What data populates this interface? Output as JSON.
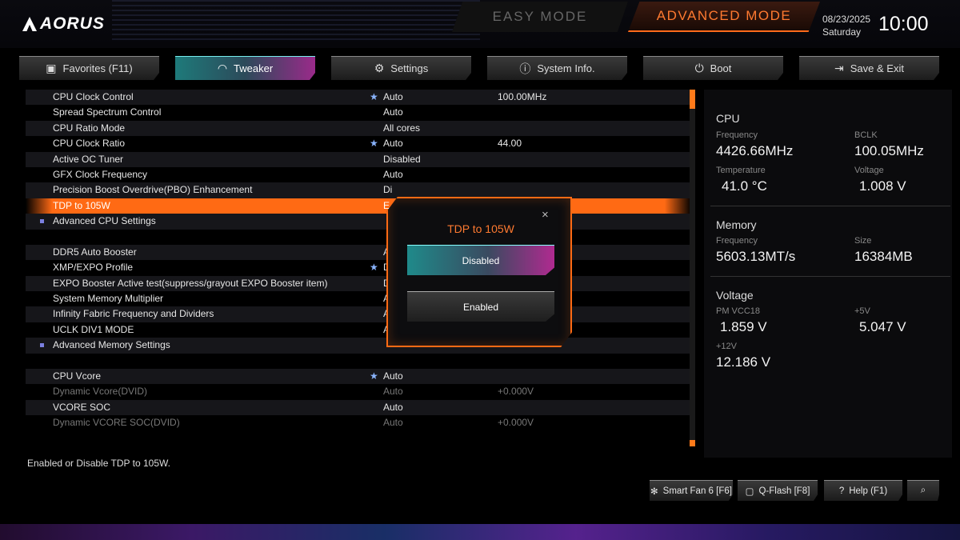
{
  "header": {
    "logo": "AORUS",
    "easy_mode": "EASY MODE",
    "advanced_mode": "ADVANCED MODE",
    "date": "08/23/2025",
    "weekday": "Saturday",
    "time": "10:00"
  },
  "tabs": [
    {
      "label": "Favorites (F11)",
      "icon": "folder-star-icon"
    },
    {
      "label": "Tweaker",
      "icon": "speedometer-icon"
    },
    {
      "label": "Settings",
      "icon": "gear-icon"
    },
    {
      "label": "System Info.",
      "icon": "info-icon"
    },
    {
      "label": "Boot",
      "icon": "power-icon"
    },
    {
      "label": "Save & Exit",
      "icon": "exit-icon"
    }
  ],
  "active_tab": "Tweaker",
  "rows": [
    {
      "label": "CPU Clock Control",
      "star": true,
      "value": "Auto",
      "value2": "100.00MHz"
    },
    {
      "label": "Spread Spectrum Control",
      "value": "Auto"
    },
    {
      "label": "CPU Ratio Mode",
      "value": "All cores"
    },
    {
      "label": "CPU Clock Ratio",
      "star": true,
      "value": "Auto",
      "value2": "44.00"
    },
    {
      "label": "Active OC Tuner",
      "value": "Disabled"
    },
    {
      "label": "GFX Clock Frequency",
      "value": "Auto"
    },
    {
      "label": "Precision Boost Overdrive(PBO) Enhancement",
      "value": "Di"
    },
    {
      "label": "TDP to 105W",
      "value": "E"
    },
    {
      "label": "Advanced CPU Settings",
      "submenu": true
    },
    {
      "label": "",
      "spacer": true
    },
    {
      "label": "DDR5 Auto Booster",
      "value": "A"
    },
    {
      "label": "XMP/EXPO Profile",
      "star": true,
      "value": "D"
    },
    {
      "label": "EXPO Booster Active test(suppress/grayout EXPO Booster item)",
      "value": "D"
    },
    {
      "label": "System Memory Multiplier",
      "value": "A"
    },
    {
      "label": "Infinity Fabric Frequency and Dividers",
      "value": "A"
    },
    {
      "label": "UCLK DIV1 MODE",
      "value": "Auto"
    },
    {
      "label": "Advanced Memory Settings",
      "submenu": true
    },
    {
      "label": "",
      "spacer": true
    },
    {
      "label": "CPU Vcore",
      "star": true,
      "value": "Auto"
    },
    {
      "label": "Dynamic Vcore(DVID)",
      "value": "Auto",
      "value2": "+0.000V",
      "dim": true
    },
    {
      "label": "VCORE SOC",
      "value": "Auto"
    },
    {
      "label": "Dynamic VCORE SOC(DVID)",
      "value": "Auto",
      "value2": "+0.000V",
      "dim": true
    }
  ],
  "selected_row": "TDP to 105W",
  "help_text": "Enabled or Disable TDP to 105W.",
  "panel": {
    "cpu": {
      "title": "CPU",
      "frequency_label": "Frequency",
      "frequency": "4426.66MHz",
      "bclk_label": "BCLK",
      "bclk": "100.05MHz",
      "temperature_label": "Temperature",
      "temperature": "41.0 °C",
      "voltage_label": "Voltage",
      "voltage": "1.008 V"
    },
    "memory": {
      "title": "Memory",
      "frequency_label": "Frequency",
      "frequency": "5603.13MT/s",
      "size_label": "Size",
      "size": "16384MB"
    },
    "voltage": {
      "title": "Voltage",
      "pm_vcc18_label": "PM VCC18",
      "pm_vcc18": "1.859 V",
      "v5_label": "+5V",
      "v5": "5.047 V",
      "v12_label": "+12V",
      "v12": "12.186 V"
    }
  },
  "modal": {
    "title": "TDP to 105W",
    "close": "×",
    "options": [
      "Disabled",
      "Enabled"
    ],
    "highlighted": "Disabled"
  },
  "bottom_buttons": [
    {
      "label": "Smart Fan 6 [F6]",
      "icon": "fan-icon"
    },
    {
      "label": "Q-Flash [F8]",
      "icon": "chip-icon"
    },
    {
      "label": "Help (F1)",
      "icon": "help-icon"
    },
    {
      "label": "",
      "icon": "search-icon"
    }
  ],
  "colors": {
    "accent": "#ff6a14",
    "tab_active_start": "#1e7a7a",
    "tab_active_end": "#9a2a8a",
    "star": "#8ab4ff"
  }
}
